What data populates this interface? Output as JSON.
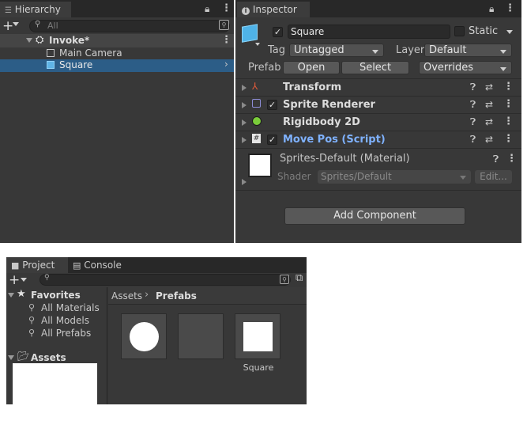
{
  "hierarchy": {
    "tab_label": "Hierarchy",
    "search_placeholder": "All",
    "scene_name": "Invoke*",
    "items": [
      {
        "label": "Main Camera"
      },
      {
        "label": "Square"
      }
    ]
  },
  "inspector": {
    "tab_label": "Inspector",
    "object_name": "Square",
    "static_label": "Static",
    "tag_label": "Tag",
    "tag_value": "Untagged",
    "layer_label": "Layer",
    "layer_value": "Default",
    "prefab_label": "Prefab",
    "open_label": "Open",
    "select_label": "Select",
    "overrides_label": "Overrides",
    "components": [
      {
        "name": "Transform"
      },
      {
        "name": "Sprite Renderer"
      },
      {
        "name": "Rigidbody 2D"
      },
      {
        "name": "Move Pos (Script)"
      }
    ],
    "material_name": "Sprites-Default (Material)",
    "shader_label": "Shader",
    "shader_value": "Sprites/Default",
    "edit_label": "Edit...",
    "add_component_label": "Add Component"
  },
  "project": {
    "tab_project": "Project",
    "tab_console": "Console",
    "favorites_label": "Favorites",
    "favorites": [
      "All Materials",
      "All Models",
      "All Prefabs"
    ],
    "assets_label": "Assets",
    "breadcrumb_root": "Assets",
    "breadcrumb_current": "Prefabs",
    "items": [
      {
        "label": ""
      },
      {
        "label": ""
      },
      {
        "label": "Square"
      }
    ]
  },
  "colors": {
    "script_blue": "#7fb2ff",
    "panel_bg": "#383838"
  }
}
